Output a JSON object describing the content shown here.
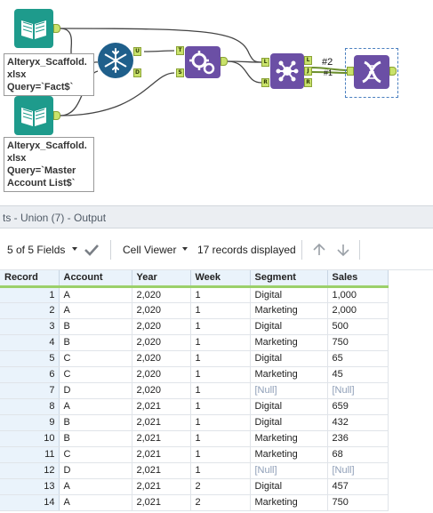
{
  "canvas": {
    "annotations": {
      "fact": "Alteryx_Scaffold.\nxlsx\nQuery=`Fact$`",
      "master": "Alteryx_Scaffold.\nxlsx\nQuery=`Master\nAccount List$`"
    },
    "anchors": {
      "append_u": "U",
      "append_d": "D",
      "formula_t": "T",
      "formula_s": "S",
      "join_l_in": "L",
      "join_r_in": "R",
      "join_l_out": "L",
      "join_j_out": "J",
      "join_r_out": "R"
    },
    "connection_labels": {
      "first": "#2",
      "second": "#1"
    },
    "colors": {
      "input_tool": "#1e9b8c",
      "append_tool": "#1f5f8b",
      "formula_tool": "#6b4fa5",
      "join_tool": "#6b4fa5",
      "union_tool": "#6b4fa5",
      "anchor": "#c9e26b"
    }
  },
  "results": {
    "title": "ts - Union (7) - Output",
    "toolbar": {
      "fields": "5 of 5 Fields",
      "viewer": "Cell Viewer",
      "records": "17 records displayed"
    },
    "columns": [
      "Record",
      "Account",
      "Year",
      "Week",
      "Segment",
      "Sales"
    ],
    "rows": [
      [
        "1",
        "A",
        "2,020",
        "1",
        "Digital",
        "1,000"
      ],
      [
        "2",
        "A",
        "2,020",
        "1",
        "Marketing",
        "2,000"
      ],
      [
        "3",
        "B",
        "2,020",
        "1",
        "Digital",
        "500"
      ],
      [
        "4",
        "B",
        "2,020",
        "1",
        "Marketing",
        "750"
      ],
      [
        "5",
        "C",
        "2,020",
        "1",
        "Digital",
        "65"
      ],
      [
        "6",
        "C",
        "2,020",
        "1",
        "Marketing",
        "45"
      ],
      [
        "7",
        "D",
        "2,020",
        "1",
        "[Null]",
        "[Null]"
      ],
      [
        "8",
        "A",
        "2,021",
        "1",
        "Digital",
        "659"
      ],
      [
        "9",
        "B",
        "2,021",
        "1",
        "Digital",
        "432"
      ],
      [
        "10",
        "B",
        "2,021",
        "1",
        "Marketing",
        "236"
      ],
      [
        "11",
        "C",
        "2,021",
        "1",
        "Marketing",
        "68"
      ],
      [
        "12",
        "D",
        "2,021",
        "1",
        "[Null]",
        "[Null]"
      ],
      [
        "13",
        "A",
        "2,021",
        "2",
        "Digital",
        "457"
      ],
      [
        "14",
        "A",
        "2,021",
        "2",
        "Marketing",
        "750"
      ]
    ]
  }
}
